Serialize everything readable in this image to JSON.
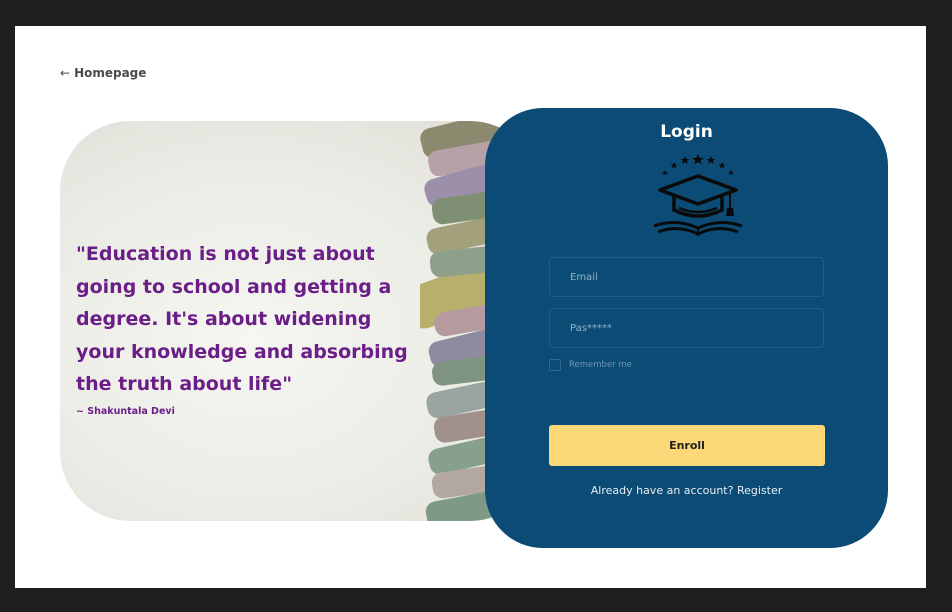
{
  "nav": {
    "back_arrow": "←",
    "back_label": "Homepage"
  },
  "hero": {
    "quote": "\"Education is not just about going to school and getting a degree. It's about widening your knowledge and absorbing the truth about life\"",
    "author": "~ Shakuntala Devi"
  },
  "login": {
    "title": "Login",
    "logo_icon": "graduation-cap-with-stars-and-open-book",
    "email_placeholder": "Email",
    "password_placeholder": "Pas*****",
    "remember_label": "Remember me",
    "enroll_label": "Enroll",
    "register_text": "Already have an account? Register"
  },
  "colors": {
    "panel": "#0b4b75",
    "accent_button": "#fcd878",
    "quote_text": "#6b1d88"
  }
}
